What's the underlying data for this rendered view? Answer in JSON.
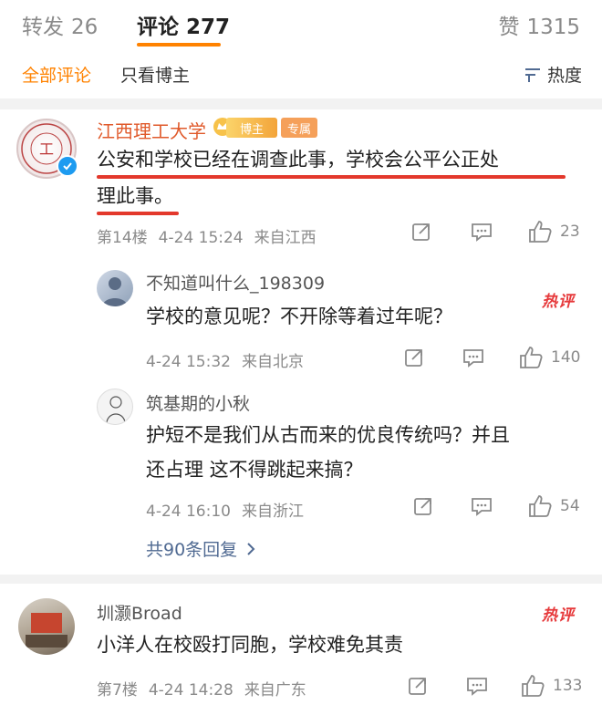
{
  "tabs": {
    "repost_label": "转发",
    "repost_count": "26",
    "comment_label": "评论",
    "comment_count": "277",
    "like_label": "赞",
    "like_count": "1315"
  },
  "filters": {
    "all": "全部评论",
    "author_only": "只看博主",
    "sort": "热度"
  },
  "comments": [
    {
      "name": "江西理工大学",
      "badge_bozhu": "博主",
      "badge_special": "专属",
      "line1": "公安和学校已经在调查此事，学校会公平公正处",
      "line2": "理此事。",
      "meta_floor": "第14楼",
      "meta_time": "4-24 15:24",
      "meta_from": "来自江西",
      "likes": "23"
    }
  ],
  "replies": [
    {
      "name": "不知道叫什么_198309",
      "hot": "热评",
      "text": "学校的意见呢？不开除等着过年呢？",
      "meta_time": "4-24 15:32",
      "meta_from": "来自北京",
      "likes": "140"
    },
    {
      "name": "筑基期的小秋",
      "line1": "护短不是我们从古而来的优良传统吗？并且",
      "line2": "还占理  这不得跳起来搞？",
      "meta_time": "4-24 16:10",
      "meta_from": "来自浙江",
      "likes": "54"
    }
  ],
  "more_replies": "共90条回复",
  "comment2": {
    "name": "圳灏Broad",
    "hot": "热评",
    "text": "小洋人在校殴打同胞，学校难免其责",
    "meta_floor": "第7楼",
    "meta_time": "4-24 14:28",
    "meta_from": "来自广东",
    "likes": "133"
  },
  "colors": {
    "accent": "#ff8200",
    "link": "#506a92",
    "hot": "#e6393b",
    "highlight": "#e3382c"
  }
}
